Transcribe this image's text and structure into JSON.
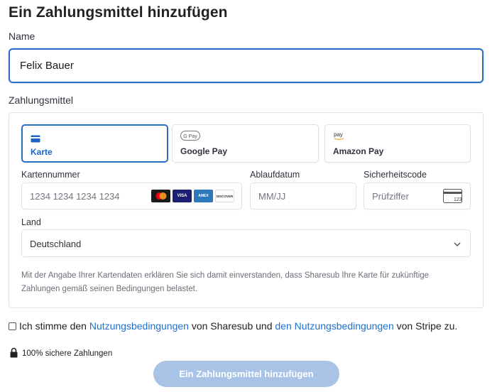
{
  "page_title": "Ein Zahlungsmittel hinzufügen",
  "name_label": "Name",
  "name_value": "Felix Bauer",
  "payment_label": "Zahlungsmittel",
  "tabs": [
    {
      "label": "Karte",
      "icon": "card-icon",
      "logo_text": ""
    },
    {
      "label": "Google Pay",
      "icon": "google-pay-icon",
      "logo_text": "G Pay"
    },
    {
      "label": "Amazon Pay",
      "icon": "amazon-pay-icon",
      "logo_text": "pay"
    }
  ],
  "card": {
    "number_label": "Kartennummer",
    "number_placeholder": "1234 1234 1234 1234",
    "brands": [
      "mastercard",
      "VISA",
      "AMEX",
      "DISCOVER"
    ],
    "expiry_label": "Ablaufdatum",
    "expiry_placeholder": "MM/JJ",
    "cvc_label": "Sicherheitscode",
    "cvc_placeholder": "Prüfziffer",
    "cvc_icon_text": "123"
  },
  "country": {
    "label": "Land",
    "value": "Deutschland"
  },
  "notice": "Mit der Angabe Ihrer Kartendaten erklären Sie sich damit einverstanden, dass Sharesub Ihre Karte für zukünftige Zahlungen gemäß seinen Bedingungen belastet.",
  "terms": {
    "part1": "Ich stimme den ",
    "link1": "Nutzungsbedingungen",
    "part2": " von Sharesub und ",
    "link2": "den Nutzungsbedingungen",
    "part3": " von Stripe zu."
  },
  "secure_text": "100% sichere Zahlungen",
  "submit_label": "Ein Zahlungsmittel hinzufügen",
  "colors": {
    "accent": "#2a6ec6",
    "link": "#1e6fd0",
    "submit_disabled": "#a8c3e6"
  }
}
